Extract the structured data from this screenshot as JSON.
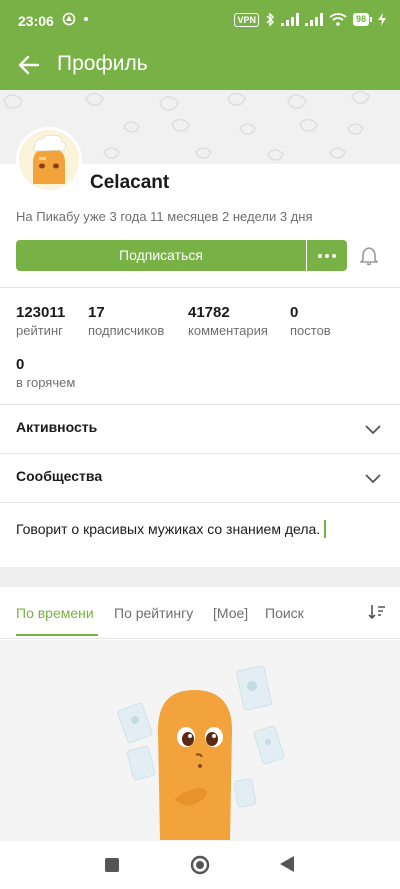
{
  "status_bar": {
    "time": "23:06",
    "vpn": "VPN",
    "battery": "98"
  },
  "toolbar": {
    "title": "Профиль"
  },
  "profile": {
    "username": "Celacant",
    "tenure": "На Пикабу уже 3 года 11 месяцев 2 недели 3 дня",
    "subscribe_label": "Подписаться"
  },
  "stats": [
    {
      "value": "123011",
      "label": "рейтинг"
    },
    {
      "value": "17",
      "label": "подписчиков"
    },
    {
      "value": "41782",
      "label": "комментария"
    },
    {
      "value": "0",
      "label": "постов"
    },
    {
      "value": "0",
      "label": "в горячем"
    }
  ],
  "sections": {
    "activity": "Активность",
    "communities": "Сообщества"
  },
  "bio": "Говорит о красивых мужиках со знанием дела.",
  "tabs": [
    {
      "label": "По времени",
      "active": true
    },
    {
      "label": "По рейтингу",
      "active": false
    },
    {
      "label": "[Мое]",
      "active": false
    },
    {
      "label": "Поиск",
      "active": false
    }
  ],
  "colors": {
    "brand_green": "#78b145",
    "text_secondary": "#6f6f6f",
    "divider": "#e4e4e4"
  }
}
